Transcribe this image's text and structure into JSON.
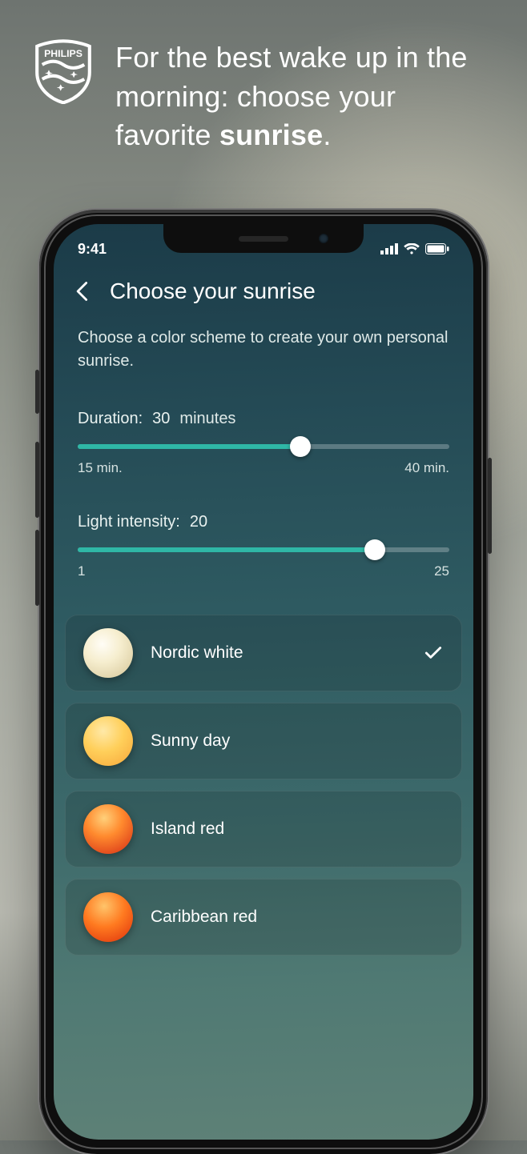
{
  "marketing": {
    "brand": "PHILIPS",
    "headline_part1": "For the best wake up in the morning: choose your favorite ",
    "headline_bold": "sunrise",
    "headline_tail": "."
  },
  "status": {
    "time": "9:41"
  },
  "nav": {
    "title": "Choose your sunrise"
  },
  "intro": "Choose a color scheme to create your own personal sunrise.",
  "duration": {
    "label": "Duration:",
    "value": "30",
    "unit": "minutes",
    "min_label": "15 min.",
    "max_label": "40 min.",
    "percent": 60
  },
  "intensity": {
    "label": "Light intensity:",
    "value": "20",
    "min_label": "1",
    "max_label": "25",
    "percent": 80
  },
  "options": [
    {
      "name": "Nordic white",
      "selected": true,
      "gradient": "radial-gradient(circle at 38% 32%, #fffdf6 0%, #f6eecf 40%, #e1d4ab 78%, #c9bc92 100%)"
    },
    {
      "name": "Sunny day",
      "selected": false,
      "gradient": "radial-gradient(circle at 40% 30%, #ffe9a8 0%, #ffcf5a 45%, #f7a63a 100%)"
    },
    {
      "name": "Island red",
      "selected": false,
      "gradient": "radial-gradient(circle at 42% 28%, #ffd07a 0%, #ff8a2e 40%, #e24a1d 80%, #b82f12 100%)"
    },
    {
      "name": "Caribbean red",
      "selected": false,
      "gradient": "radial-gradient(circle at 42% 28%, #ffc46a 0%, #ff7a20 45%, #e84712 82%, #c2330e 100%)"
    }
  ]
}
